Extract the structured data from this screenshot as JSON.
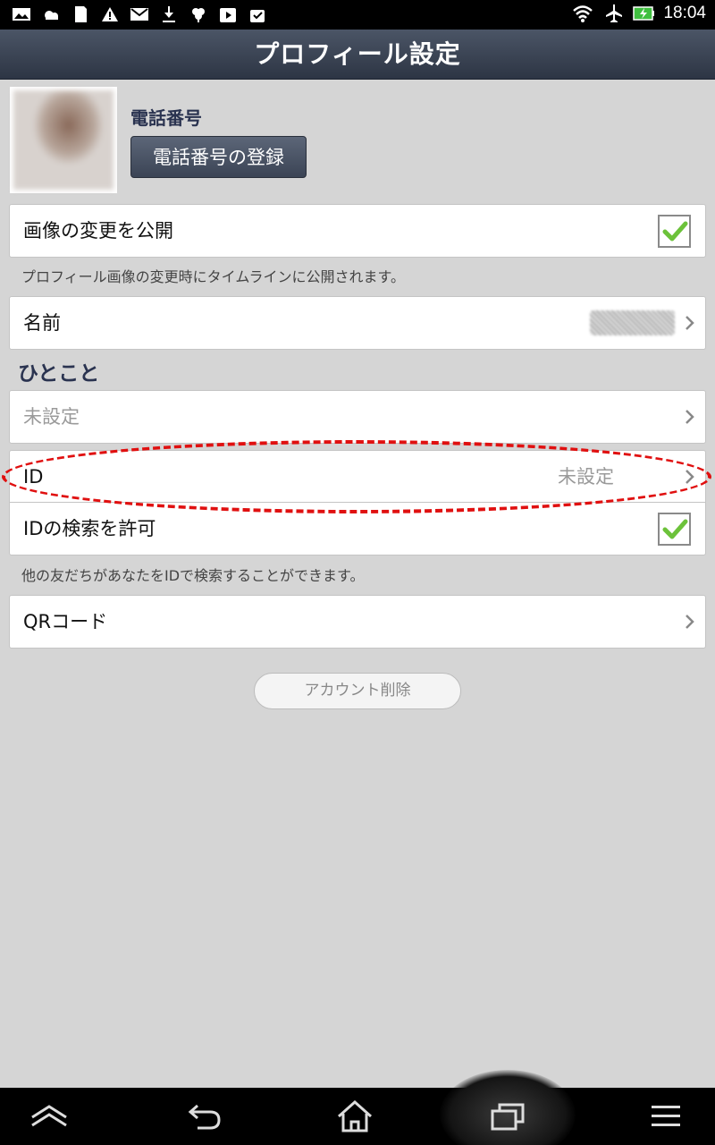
{
  "status_bar": {
    "time": "18:04",
    "left_icons": [
      "gallery-icon",
      "weather-icon",
      "sd-card-icon",
      "warning-icon",
      "mail-icon",
      "download-icon",
      "clover-icon",
      "play-store-icon",
      "shopping-bag-icon"
    ],
    "right_icons": [
      "wifi-icon",
      "airplane-icon",
      "battery-charging-icon"
    ]
  },
  "title": "プロフィール設定",
  "profile": {
    "phone_label": "電話番号",
    "phone_button": "電話番号の登録"
  },
  "rows": {
    "publish_image_change": {
      "label": "画像の変更を公開",
      "checked": true,
      "note": "プロフィール画像の変更時にタイムラインに公開されます。"
    },
    "name": {
      "label": "名前"
    },
    "status_section": "ひとこと",
    "status_message": {
      "placeholder": "未設定"
    },
    "id": {
      "label": "ID",
      "value": "未設定"
    },
    "allow_id_search": {
      "label": "IDの検索を許可",
      "checked": true,
      "note": "他の友だちがあなたをIDで検索することができます。"
    },
    "qr_code": {
      "label": "QRコード"
    }
  },
  "delete_account_button": "アカウント削除",
  "colors": {
    "title_bar": "#3b4455",
    "annotation": "#e01010",
    "check": "#6cc23a"
  },
  "nav_bar": [
    "collapse-icon",
    "back-icon",
    "home-icon",
    "recent-apps-icon",
    "menu-icon"
  ]
}
